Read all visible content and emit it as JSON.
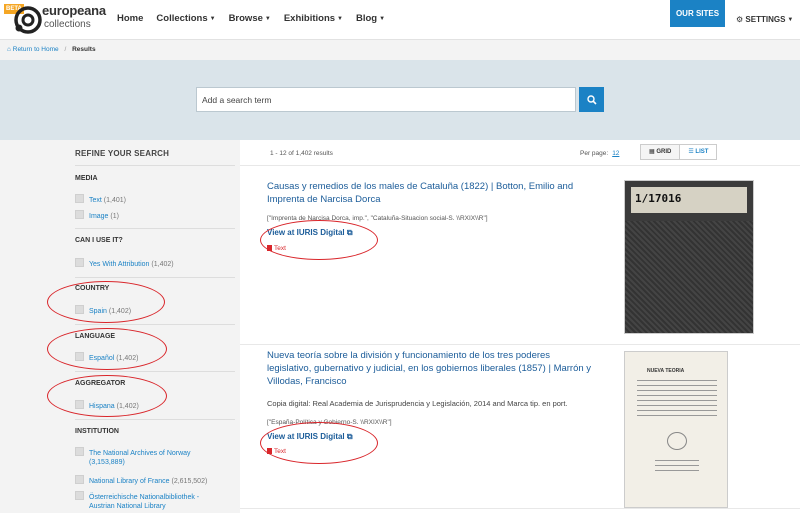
{
  "header": {
    "beta": "BETA",
    "logo_title": "europeana",
    "logo_sub": "collections",
    "nav": [
      {
        "label": "Home",
        "dropdown": false
      },
      {
        "label": "Collections",
        "dropdown": true
      },
      {
        "label": "Browse",
        "dropdown": true
      },
      {
        "label": "Exhibitions",
        "dropdown": true
      },
      {
        "label": "Blog",
        "dropdown": true
      }
    ],
    "our_sites": "OUR SITES",
    "settings": "SETTINGS"
  },
  "breadcrumb": {
    "home": "Return to Home",
    "current": "Results"
  },
  "search": {
    "placeholder": "Add a search term"
  },
  "sidebar": {
    "title": "REFINE YOUR SEARCH",
    "facets": {
      "media": {
        "heading": "MEDIA",
        "options": [
          {
            "label": "Text",
            "count": "(1,401)"
          },
          {
            "label": "Image",
            "count": "(1)"
          }
        ]
      },
      "can_i_use": {
        "heading": "CAN I USE IT?",
        "options": [
          {
            "label": "Yes With Attribution",
            "count": "(1,402)"
          }
        ]
      },
      "country": {
        "heading": "COUNTRY",
        "options": [
          {
            "label": "Spain",
            "count": "(1,402)"
          }
        ]
      },
      "language": {
        "heading": "LANGUAGE",
        "options": [
          {
            "label": "Español",
            "count": "(1,402)"
          }
        ]
      },
      "aggregator": {
        "heading": "AGGREGATOR",
        "options": [
          {
            "label": "Hispana",
            "count": "(1,402)"
          }
        ]
      },
      "institution": {
        "heading": "INSTITUTION",
        "options": [
          {
            "label": "The National Archives of Norway",
            "count": "(3,153,889)"
          },
          {
            "label": "National Library of France",
            "count": "(2,615,502)"
          },
          {
            "label": "Österreichische Nationalbibliothek -",
            "label2": "Austrian National Library",
            "count": ""
          }
        ]
      }
    }
  },
  "results": {
    "count_text": "1 - 12 of 1,402 results",
    "per_page_label": "Per page:",
    "per_page_value": "12",
    "view_grid": "GRID",
    "view_list": "LIST",
    "items": [
      {
        "title": "Causas y remedios de los males de Cataluña (1822) | Botton, Emilio and Imprenta de Narcisa Dorca",
        "meta": "[\"Imprenta de Narcisa Dorca, imp.\", \"Cataluña-Situacion social-S. \\\\RXIX\\\\R\"]",
        "view_label": "View at IURIS Digital",
        "type_label": "Text",
        "thumb_label": "1/17016"
      },
      {
        "title": "Nueva teoría sobre la división y funcionamiento de los tres poderes legislativo, gubernativo y judicial, en los gobiernos liberales (1857) | Marrón y Villodas, Francisco",
        "desc": "Copia digital: Real Academia de Jurisprudencia y Legislación, 2014 and Marca tip. en port.",
        "meta": "[\"España-Política y Gobierno-S. \\\\RXIX\\\\R\"]",
        "view_label": "View at IURIS Digital",
        "type_label": "Text",
        "thumb_label": "NUEVA TEORIA"
      }
    ]
  },
  "colors": {
    "brand_blue": "#1b82c5",
    "link_blue": "#1b5c99",
    "annotation_red": "#d9262b"
  }
}
